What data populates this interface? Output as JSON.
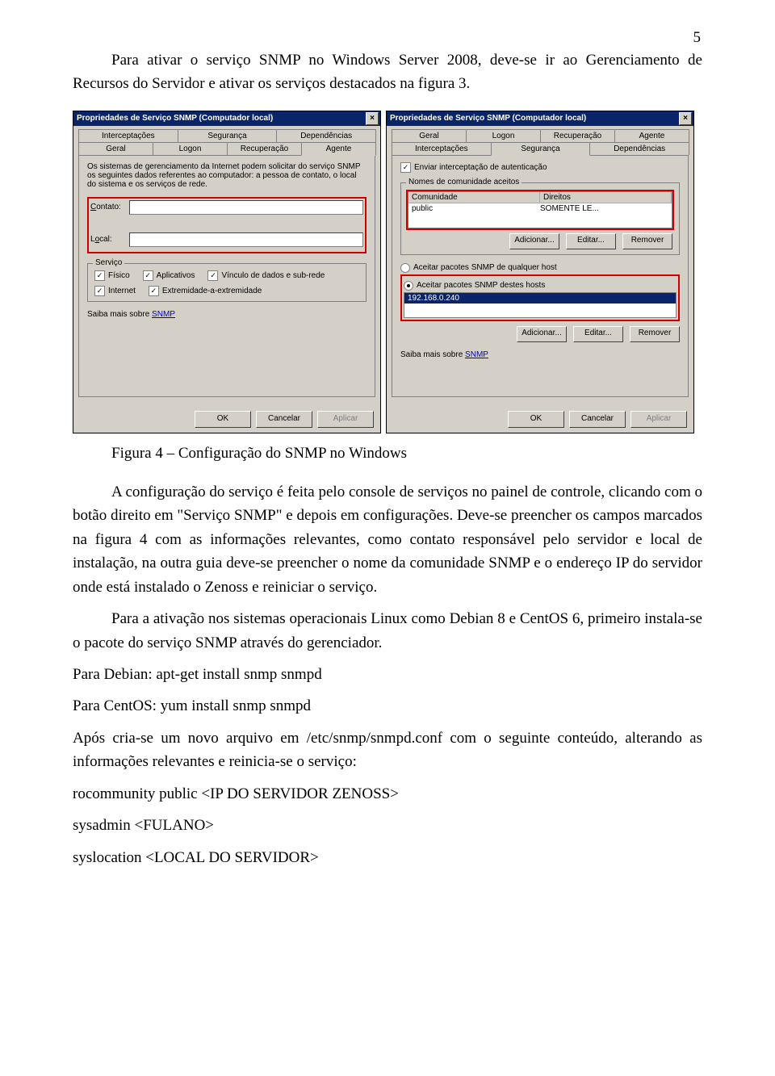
{
  "page_number": "5",
  "para1": "Para ativar o serviço SNMP no Windows Server 2008, deve-se ir ao Gerenciamento de Recursos do Servidor e ativar os serviços destacados na figura 3.",
  "figure_caption": "Figura 4 – Configuração do SNMP no Windows",
  "para2": "A configuração do serviço é feita pelo console de serviços no painel de controle, clicando com o botão direito em \"Serviço SNMP\" e depois em configurações. Deve-se preencher os campos marcados na figura 4 com as informações relevantes, como contato responsável pelo servidor e local de instalação, na outra guia deve-se preencher o nome da comunidade SNMP e o endereço IP do servidor onde está instalado o Zenoss e reiniciar o serviço.",
  "para3": "Para a ativação nos sistemas operacionais Linux como Debian 8 e CentOS 6, primeiro instala-se o pacote do serviço SNMP através do gerenciador.",
  "line1": "Para Debian: apt-get install snmp snmpd",
  "line2": "Para CentOS:  yum install snmp snmpd",
  "line3": "Após cria-se um novo arquivo em /etc/snmp/snmpd.conf com o seguinte conteúdo, alterando as informações relevantes e reinicia-se o serviço:",
  "line4": "rocommunity public <IP DO SERVIDOR ZENOSS>",
  "line5": "sysadmin <FULANO>",
  "line6": "syslocation <LOCAL DO SERVIDOR>",
  "dlg1": {
    "title": "Propriedades de Serviço SNMP (Computador local)",
    "tabs_row1": [
      "Interceptações",
      "Segurança",
      "Dependências"
    ],
    "tabs_row2": [
      "Geral",
      "Logon",
      "Recuperação",
      "Agente"
    ],
    "desc": "Os sistemas de gerenciamento da Internet podem solicitar do serviço SNMP os seguintes dados referentes ao computador: a pessoa de contato, o local do sistema e os serviços de rede.",
    "contato": "Contato:",
    "local": "Local:",
    "servico": "Serviço",
    "chk1": "Físico",
    "chk2": "Aplicativos",
    "chk3": "Vínculo de dados e sub-rede",
    "chk4": "Internet",
    "chk5": "Extremidade-a-extremidade",
    "saiba": "Saiba mais sobre ",
    "snmp": "SNMP",
    "ok": "OK",
    "cancel": "Cancelar",
    "apply": "Aplicar"
  },
  "dlg2": {
    "title": "Propriedades de Serviço SNMP (Computador local)",
    "tabs_row1": [
      "Geral",
      "Logon",
      "Recuperação",
      "Agente"
    ],
    "tabs_row2": [
      "Interceptações",
      "Segurança",
      "Dependências"
    ],
    "auth_chk": "Enviar interceptação de autenticação",
    "group1": "Nomes de comunidade aceitos",
    "col1": "Comunidade",
    "col2": "Direitos",
    "row_c": "public",
    "row_d": "SOMENTE LE...",
    "add": "Adicionar...",
    "edit": "Editar...",
    "remove": "Remover",
    "radio1": "Aceitar pacotes SNMP de qualquer host",
    "radio2": "Aceitar pacotes SNMP destes hosts",
    "host": "192.168.0.240",
    "saiba": "Saiba mais sobre ",
    "snmp": "SNMP",
    "ok": "OK",
    "cancel": "Cancelar",
    "apply": "Aplicar"
  }
}
